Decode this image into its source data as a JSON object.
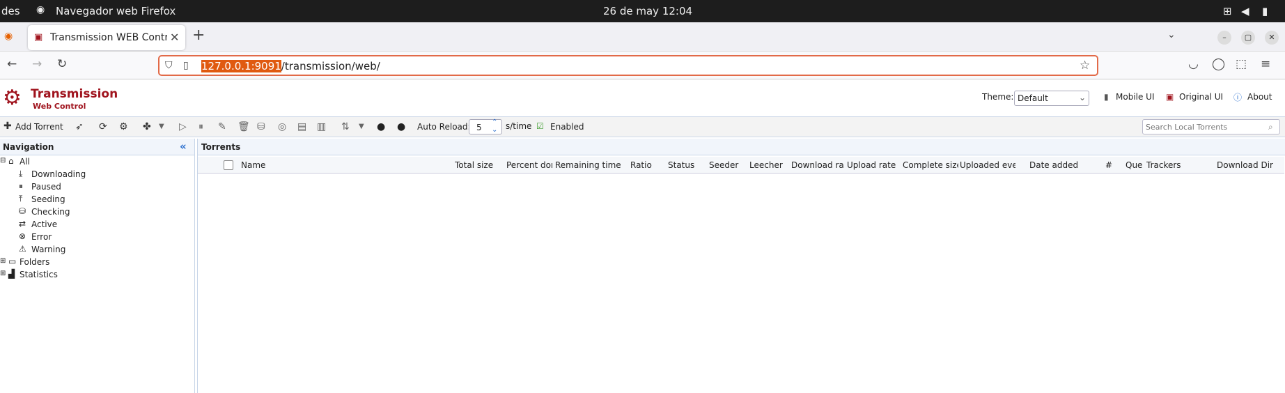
{
  "os_bar": {
    "left_text": "des",
    "app_name": "Navegador web Firefox",
    "clock": "26 de may  12:04"
  },
  "browser": {
    "tab_title": "Transmission WEB Control",
    "url_highlight": "127.0.0.1:9091",
    "url_rest": "/transmission/web/",
    "new_tab": "+"
  },
  "app": {
    "brand_title": "Transmission",
    "brand_subtitle": "Web Control",
    "theme_label": "Theme:",
    "theme_value": "Default",
    "mobile_ui": "Mobile UI",
    "original_ui": "Original UI",
    "about": "About"
  },
  "toolbar": {
    "add_torrent": "Add Torrent",
    "auto_reload_label": "Auto Reload:",
    "auto_reload_value": "5",
    "unit": "s/time",
    "enabled": "Enabled",
    "search_placeholder": "Search Local Torrents"
  },
  "navigation": {
    "title": "Navigation",
    "collapse": "«",
    "items": [
      "All",
      "Downloading",
      "Paused",
      "Seeding",
      "Checking",
      "Active",
      "Error",
      "Warning",
      "Folders",
      "Statistics"
    ]
  },
  "torrents": {
    "title": "Torrents",
    "columns": [
      "Name",
      "Total size",
      "Percent don",
      "Remaining time",
      "Ratio",
      "Status",
      "Seeder",
      "Leecher",
      "Download rat",
      "Upload rate",
      "Complete size",
      "Uploaded eve",
      "Date added",
      "#",
      "Que",
      "Trackers",
      "Download Dir"
    ]
  },
  "colors": {
    "brand_red": "#a0141e",
    "accent_orange": "#e26a48"
  }
}
